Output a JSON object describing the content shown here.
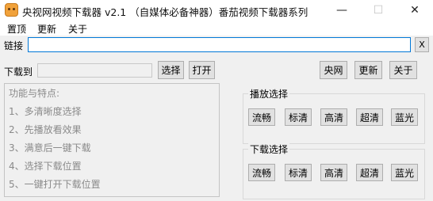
{
  "window": {
    "title": "央视网视频下载器  v2.1  （自媒体必备神器）番茄视频下载器系列",
    "minimize_glyph": "—",
    "maximize_glyph": "☐",
    "close_glyph": "✕"
  },
  "menu": [
    "置顶",
    "更新",
    "关于"
  ],
  "url_row": {
    "label": "链接",
    "value": "",
    "clear_label": "X"
  },
  "download_row": {
    "label": "下载到",
    "path_value": "",
    "choose_label": "选择",
    "open_label": "打开",
    "cctv_label": "央网",
    "update_label": "更新",
    "about_label": "关于"
  },
  "features": [
    "功能与特点:",
    "1、多清晰度选择",
    "2、先播放看效果",
    "3、满意后一键下载",
    "4、选择下载位置",
    "5、一键打开下载位置"
  ],
  "play_group": {
    "title": "播放选择",
    "buttons": [
      "流畅",
      "标清",
      "高清",
      "超清",
      "蓝光"
    ]
  },
  "download_group": {
    "title": "下载选择",
    "buttons": [
      "流畅",
      "标清",
      "高清",
      "超清",
      "蓝光"
    ]
  }
}
